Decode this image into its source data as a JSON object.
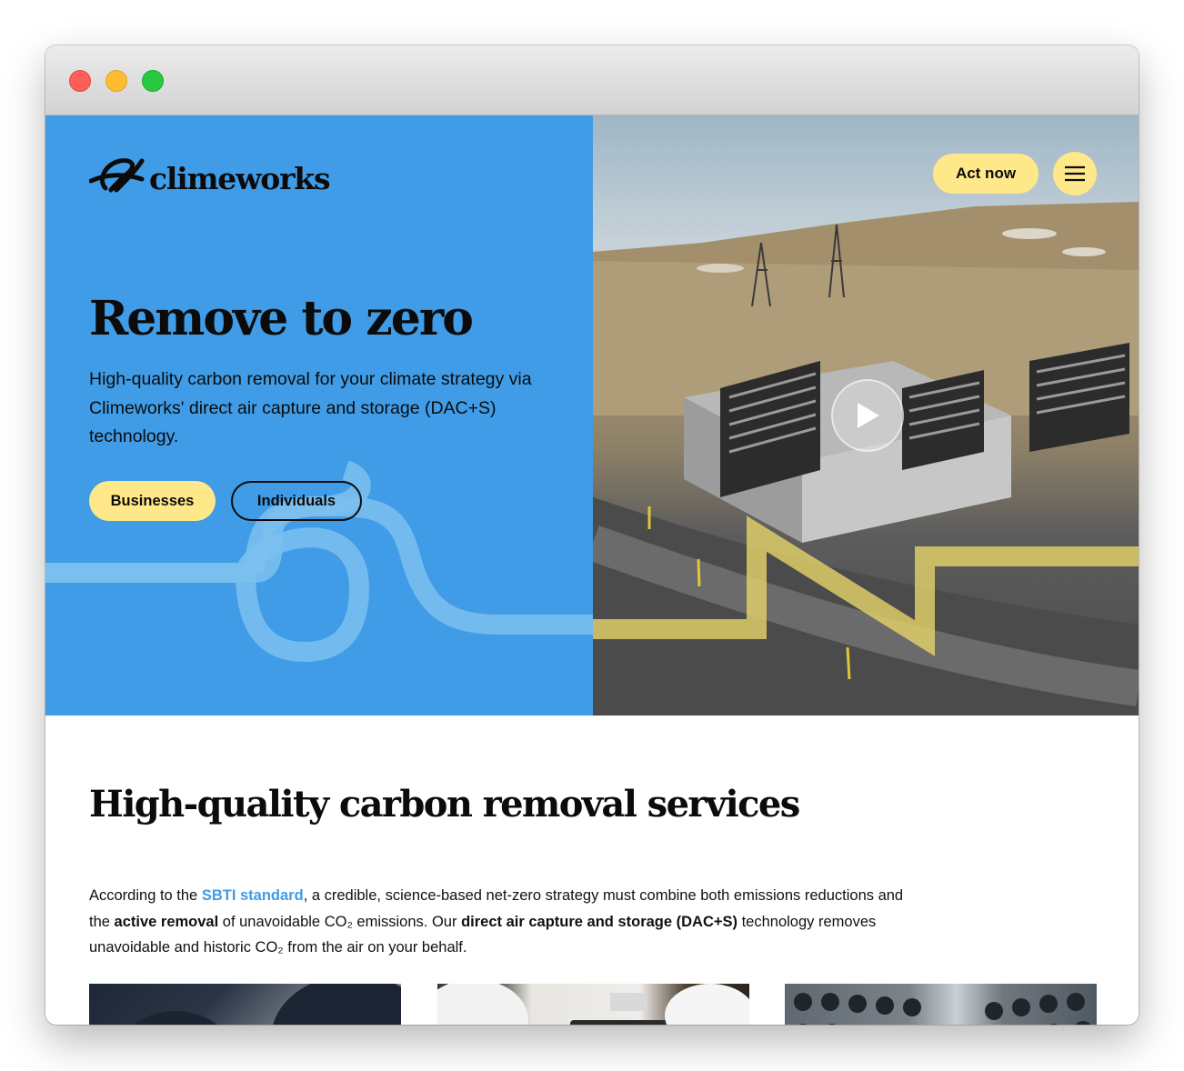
{
  "window": {
    "controls": [
      "close",
      "minimize",
      "zoom"
    ]
  },
  "header": {
    "logo_text": "climeworks",
    "logo_icon": "climeworks-swirl-logo",
    "act_now_label": "Act now",
    "menu_icon": "hamburger-menu-icon"
  },
  "hero": {
    "title": "Remove to zero",
    "subtitle": "High-quality carbon removal for your climate strategy via Climeworks' direct air capture and storage (DAC+S) technology.",
    "businesses_label": "Businesses",
    "individuals_label": "Individuals",
    "video_play_icon": "play-icon",
    "accent_yellow": "#ffe88a",
    "accent_blue": "#409ce6"
  },
  "services": {
    "title": "High-quality carbon removal services",
    "body_1": "According to the ",
    "link_sbti": "SBTI standard",
    "body_2": ", a credible, science-based net-zero strategy must combine both emissions reductions and the ",
    "bold_active": "active removal",
    "body_3": " of unavoidable CO₂ emissions. Our ",
    "bold_dac": "direct air capture and storage (DAC+S)",
    "body_4": " technology removes unavoidable and historic CO₂ from the air on your behalf."
  }
}
